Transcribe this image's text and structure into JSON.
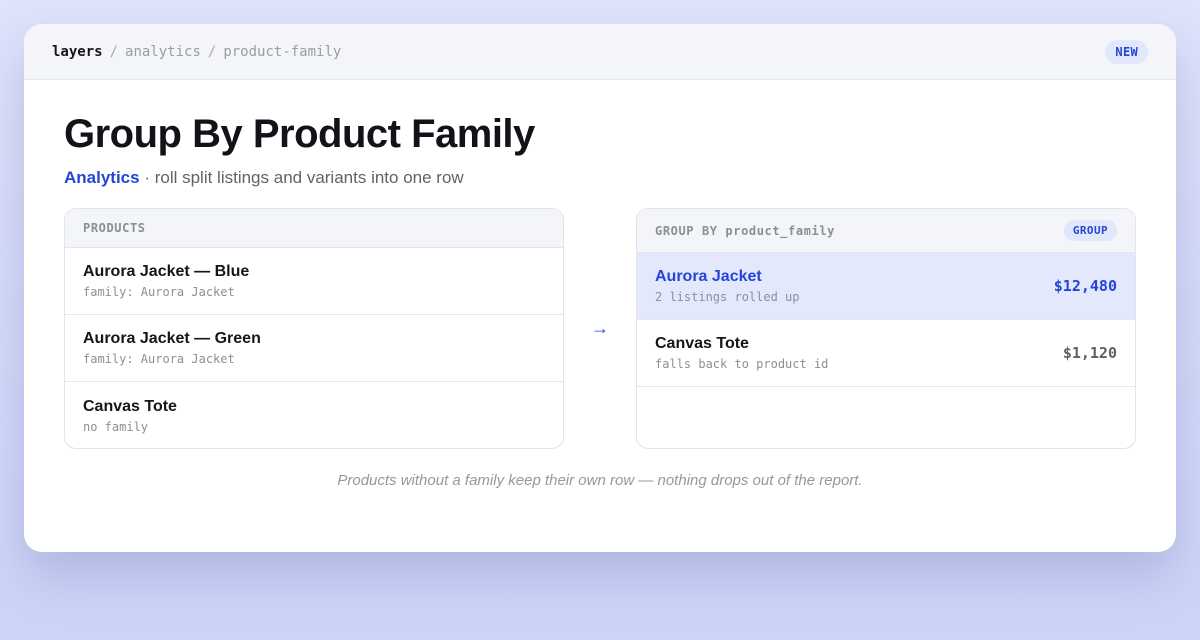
{
  "breadcrumb": {
    "root": "layers",
    "sep1": "/",
    "section": "analytics",
    "sep2": "/",
    "page": "product-family"
  },
  "badge": "NEW",
  "title": "Group By Product Family",
  "subtitle": {
    "tag": "Analytics",
    "text": " · roll split listings and variants into one row"
  },
  "products": {
    "header": "PRODUCTS",
    "items": [
      {
        "name": "Aurora Jacket — Blue",
        "meta": "family: Aurora Jacket"
      },
      {
        "name": "Aurora Jacket — Green",
        "meta": "family: Aurora Jacket"
      },
      {
        "name": "Canvas Tote",
        "meta": "no family"
      }
    ]
  },
  "arrow": "→",
  "grouped": {
    "header": "GROUP BY product_family",
    "badge": "GROUP",
    "items": [
      {
        "name": "Aurora Jacket",
        "meta": "2 listings rolled up",
        "amount": "$12,480",
        "highlighted": true
      },
      {
        "name": "Canvas Tote",
        "meta": "falls back to product id",
        "amount": "$1,120",
        "highlighted": false
      }
    ]
  },
  "footnote": "Products without a family keep their own row — nothing drops out of the report.",
  "colors": {
    "accent": "#2446d8",
    "highlight": "#e3e8fd",
    "background": "#dfe3fb"
  }
}
